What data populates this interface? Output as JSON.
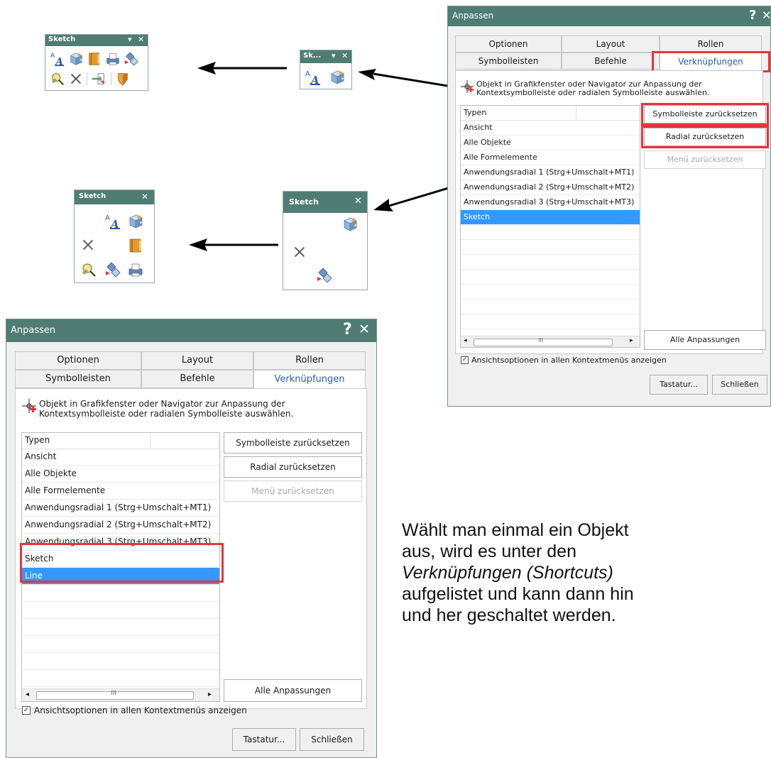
{
  "dialog": {
    "title": "Anpassen",
    "help_glyph": "?",
    "close_glyph": "✕",
    "tabs_row1": [
      "Optionen",
      "Layout",
      "Rollen"
    ],
    "tabs_row2": [
      "Symbolleisten",
      "Befehle",
      "Verknüpfungen"
    ],
    "active_tab": "Verknüpfungen",
    "info_line1": "Objekt in Grafikfenster oder Navigator zur Anpassung der",
    "info_line2": "Kontextsymbolleiste oder radialen Symbolleiste auswählen.",
    "list_header": "Typen",
    "buttons": {
      "reset_toolbar": "Symbolleiste zurücksetzen",
      "reset_radial": "Radial zurücksetzen",
      "reset_menu": "Menü zurücksetzen",
      "all_customizations": "Alle Anpassungen",
      "keyboard": "Tastatur...",
      "close": "Schließen"
    },
    "checkbox_label": "Ansichtsoptionen in allen Kontextmenüs anzeigen",
    "checkbox_checked": true,
    "scroll_glyph": "III"
  },
  "dialog_top": {
    "rows": [
      "Ansicht",
      "Alle Objekte",
      "Alle Formelemente",
      "Anwendungsradial 1 (Strg+Umschalt+MT1)",
      "Anwendungsradial 2 (Strg+Umschalt+MT2)",
      "Anwendungsradial 3 (Strg+Umschalt+MT3)",
      "Sketch"
    ],
    "selected": "Sketch"
  },
  "dialog_bottom": {
    "rows": [
      "Ansicht",
      "Alle Objekte",
      "Alle Formelemente",
      "Anwendungsradial 1 (Strg+Umschalt+MT1)",
      "Anwendungsradial 2 (Strg+Umschalt+MT2)",
      "Anwendungsradial 3 (Strg+Umschalt+MT3)",
      "Sketch",
      "Line"
    ],
    "selected": "Line"
  },
  "toolbars": {
    "full_title": "Sketch",
    "short_title": "Sk...",
    "radial_title": "Sketch",
    "dropdown_glyph": "▾",
    "close_glyph": "✕"
  },
  "icons": {
    "text": "text-style-icon",
    "box": "sketch-box-icon",
    "book": "book-icon",
    "printer": "printer-icon",
    "diamonds": "diamond-arrows-icon",
    "magnifier": "magnifier-icon",
    "delete": "delete-x-icon",
    "export": "export-icon",
    "shield": "shield-icon"
  },
  "colors": {
    "title_bar": "#4f7d74",
    "selection": "#3399ff",
    "highlight": "#e8333a",
    "active_tab_text": "#2b5cab"
  },
  "description": {
    "line1": "Wählt man einmal ein Objekt",
    "line2": "aus, wird es unter den",
    "line3": "Verknüpfungen (Shortcuts)",
    "line4": "aufgelistet und kann dann hin",
    "line5": "und her geschaltet werden."
  }
}
